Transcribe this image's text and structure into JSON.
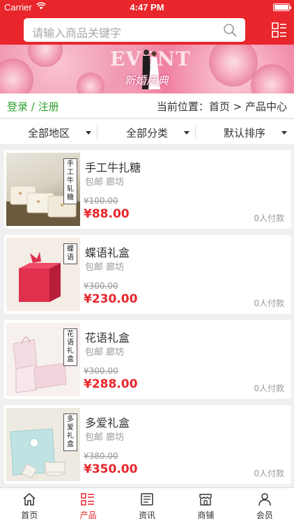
{
  "status_bar": {
    "carrier": "Carrier",
    "time": "4:47 PM"
  },
  "header": {
    "search_placeholder": "请输入商品关键字",
    "accent": "#e8262b"
  },
  "banner": {
    "event_text": "EVENT",
    "subtitle": "新婚庆典"
  },
  "crumb": {
    "login": "登录 / 注册",
    "location": "当前位置：首页 > 产品中心"
  },
  "filters": [
    "全部地区",
    "全部分类",
    "默认排序"
  ],
  "products": [
    {
      "name": "手工牛扎糖",
      "tags": "包邮 廊坊",
      "old_price": "¥100.00",
      "price": "¥88.00",
      "paid": "0人付款",
      "thumb_label": "手工牛轧糖",
      "thumb_icon": "nougat-photo"
    },
    {
      "name": "蝶语礼盒",
      "tags": "包邮 廊坊",
      "old_price": "¥300.00",
      "price": "¥230.00",
      "paid": "0人付款",
      "thumb_label": "蝶语",
      "thumb_icon": "red-gift-box-photo"
    },
    {
      "name": "花语礼盒",
      "tags": "包邮 廊坊",
      "old_price": "¥300.00",
      "price": "¥288.00",
      "paid": "0人付款",
      "thumb_label": "花语礼盒",
      "thumb_icon": "pink-gift-box-photo"
    },
    {
      "name": "多爱礼盒",
      "tags": "包邮 廊坊",
      "old_price": "¥380.00",
      "price": "¥350.00",
      "paid": "0人付款",
      "thumb_label": "多爱礼盒",
      "thumb_icon": "blue-gift-box-photo"
    }
  ],
  "tabs": [
    {
      "label": "首页",
      "icon": "home-icon",
      "active": false
    },
    {
      "label": "产品",
      "icon": "product-list-icon",
      "active": true
    },
    {
      "label": "资讯",
      "icon": "news-icon",
      "active": false
    },
    {
      "label": "商铺",
      "icon": "shop-icon",
      "active": false
    },
    {
      "label": "会员",
      "icon": "member-icon",
      "active": false
    }
  ]
}
